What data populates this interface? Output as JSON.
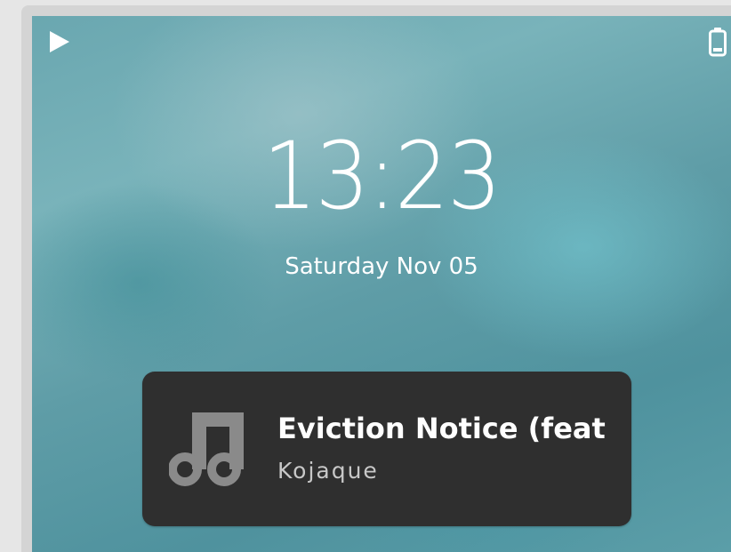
{
  "status_bar": {
    "left_icon": "play-icon",
    "right_icon": "battery-icon"
  },
  "lockscreen": {
    "time": "13:23",
    "date": "Saturday Nov 05"
  },
  "now_playing": {
    "icon": "music-note-icon",
    "title": "Eviction Notice (feat",
    "artist": "Kojaque"
  },
  "colors": {
    "card_background": "#2f2f2f",
    "icon_gray": "#8a8a8a",
    "text_primary": "#ffffff",
    "text_secondary": "#c8c8c8"
  }
}
